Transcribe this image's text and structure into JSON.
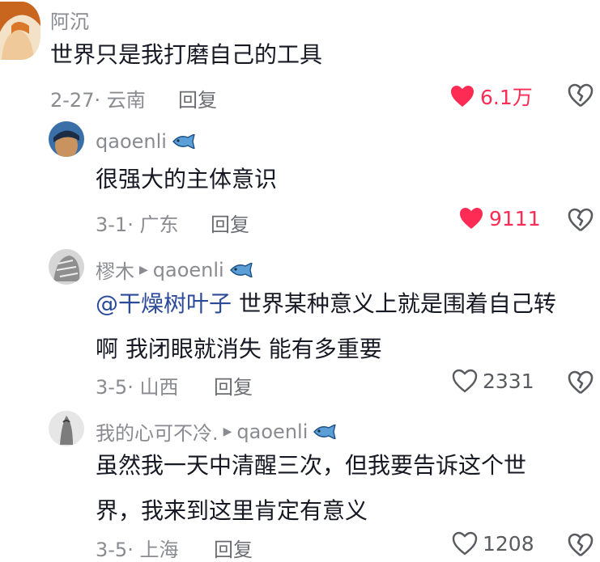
{
  "comments": [
    {
      "username": "阿沉",
      "text_lines": [
        "世界只是我打磨自己的工具"
      ],
      "date": "2-27",
      "location": "云南",
      "reply_label": "回复",
      "likes": "6.1万",
      "liked": true
    },
    {
      "username": "qaoenli",
      "text_lines": [
        "很强大的主体意识"
      ],
      "date": "3-1",
      "location": "广东",
      "reply_label": "回复",
      "likes": "9111",
      "liked": true
    },
    {
      "username": "樛木",
      "reply_to": "qaoenli",
      "mention": "@干燥树叶子",
      "text_lines": [
        " 世界某种意义上就是围着自己转",
        "啊 我闭眼就消失 能有多重要"
      ],
      "date": "3-5",
      "location": "山西",
      "reply_label": "回复",
      "likes": "2331",
      "liked": false
    },
    {
      "username": "我的心可不冷.",
      "reply_to": "qaoenli",
      "text_lines": [
        "虽然我一天中清醒三次，但我要告诉这个世",
        "界，我来到这里肯定有意义"
      ],
      "date": "3-5",
      "location": "上海",
      "reply_label": "回复",
      "likes": "1208",
      "liked": false
    }
  ],
  "colors": {
    "liked_heart": "#fe2c55",
    "meta_gray": "#8a8b91",
    "mention_blue": "#2c4a9a"
  },
  "icons": {
    "like": "heart-icon",
    "dislike": "broken-heart-icon",
    "badge": "fish-badge-icon",
    "reply_arrow": "play-arrow-icon"
  }
}
